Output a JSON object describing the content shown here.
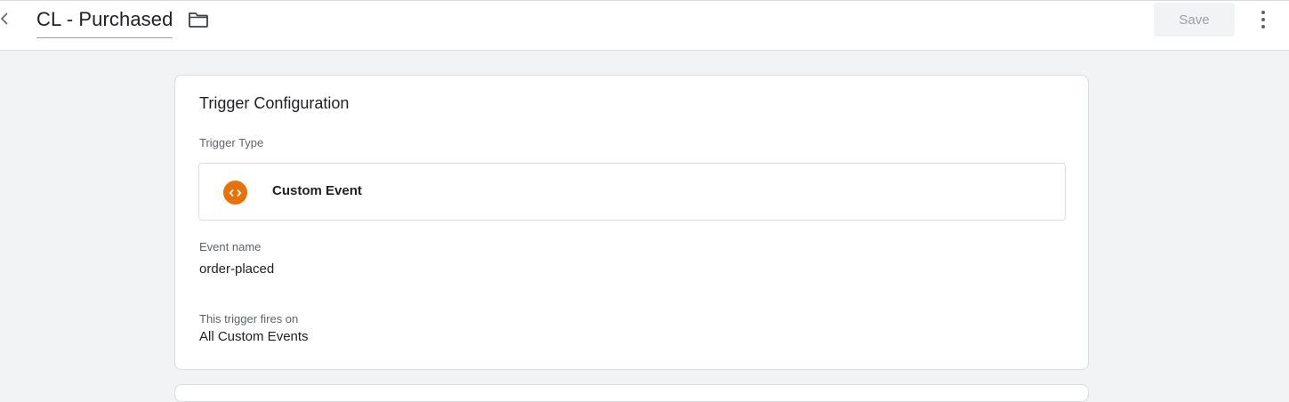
{
  "header": {
    "title": "CL - Purchased",
    "save_label": "Save",
    "back_icon": "chevron-left-icon",
    "folder_icon": "folder-icon",
    "more_icon": "more-vert-icon"
  },
  "trigger_config": {
    "section_title": "Trigger Configuration",
    "type_label": "Trigger Type",
    "type_value": "Custom Event",
    "type_icon": "code-brackets-icon",
    "type_icon_color": "#e8710a",
    "event_name_label": "Event name",
    "event_name_value": "order-placed",
    "fires_on_label": "This trigger fires on",
    "fires_on_value": "All Custom Events"
  }
}
